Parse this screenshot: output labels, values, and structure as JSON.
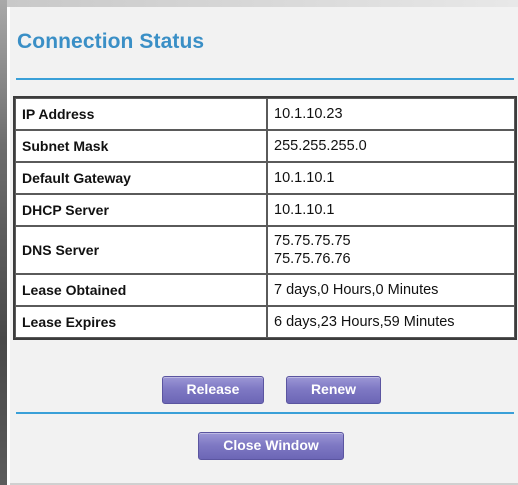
{
  "header": {
    "title": "Connection Status"
  },
  "connection_table": {
    "rows": [
      {
        "label": "IP Address",
        "values": [
          "10.1.10.23"
        ]
      },
      {
        "label": "Subnet Mask",
        "values": [
          "255.255.255.0"
        ]
      },
      {
        "label": "Default Gateway",
        "values": [
          "10.1.10.1"
        ]
      },
      {
        "label": "DHCP Server",
        "values": [
          "10.1.10.1"
        ]
      },
      {
        "label": "DNS Server",
        "values": [
          "75.75.75.75",
          "75.75.76.76"
        ]
      },
      {
        "label": "Lease Obtained",
        "values": [
          "7 days,0 Hours,0 Minutes"
        ]
      },
      {
        "label": "Lease Expires",
        "values": [
          "6 days,23 Hours,59 Minutes"
        ]
      }
    ]
  },
  "actions": {
    "release_label": "Release",
    "renew_label": "Renew",
    "close_label": "Close Window"
  },
  "colors": {
    "title": "#3a8fc6",
    "rule": "#3aa0d8",
    "button": "#7f79c4"
  }
}
